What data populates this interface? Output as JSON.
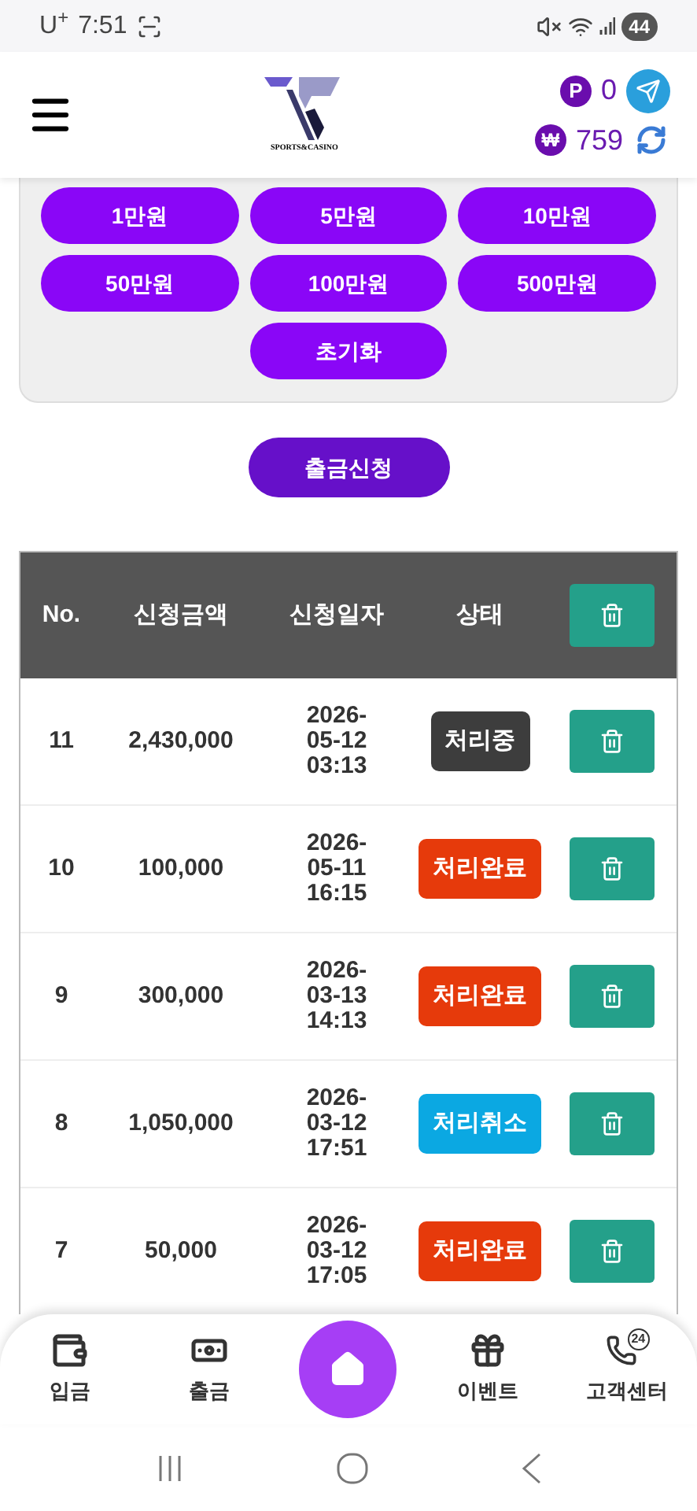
{
  "status_bar": {
    "carrier": "U",
    "carrier_mark": "+",
    "time": "7:51",
    "battery": "44"
  },
  "header": {
    "logo_caption": "SPORTS&CASINO",
    "point_symbol": "P",
    "points": "0",
    "money_symbol": "₩",
    "balance": "759"
  },
  "amount_buttons": [
    "1만원",
    "5만원",
    "10만원",
    "50만원",
    "100만원",
    "500만원",
    "초기화"
  ],
  "submit_button": "출금신청",
  "table": {
    "columns": [
      "No.",
      "신청금액",
      "신청일자",
      "상태"
    ],
    "rows": [
      {
        "no": "11",
        "amount": "2,430,000",
        "date": "2026-",
        "date2": "05-12",
        "time": "03:13",
        "status": "처리중",
        "color": "#3d3d3d"
      },
      {
        "no": "10",
        "amount": "100,000",
        "date": "2026-",
        "date2": "05-11",
        "time": "16:15",
        "status": "처리완료",
        "color": "#e63a0b"
      },
      {
        "no": "9",
        "amount": "300,000",
        "date": "2026-",
        "date2": "03-13",
        "time": "14:13",
        "status": "처리완료",
        "color": "#e63a0b"
      },
      {
        "no": "8",
        "amount": "1,050,000",
        "date": "2026-",
        "date2": "03-12",
        "time": "17:51",
        "status": "처리취소",
        "color": "#0ba8e2"
      },
      {
        "no": "7",
        "amount": "50,000",
        "date": "2026-",
        "date2": "03-12",
        "time": "17:05",
        "status": "처리완료",
        "color": "#e63a0b"
      }
    ]
  },
  "bottom_nav": [
    {
      "kind": "deposit",
      "label": "입금"
    },
    {
      "kind": "withdraw",
      "label": "출금"
    },
    {
      "kind": "home"
    },
    {
      "kind": "event",
      "label": "이벤트"
    },
    {
      "kind": "support",
      "label": "고객센터",
      "badge": "24"
    }
  ]
}
